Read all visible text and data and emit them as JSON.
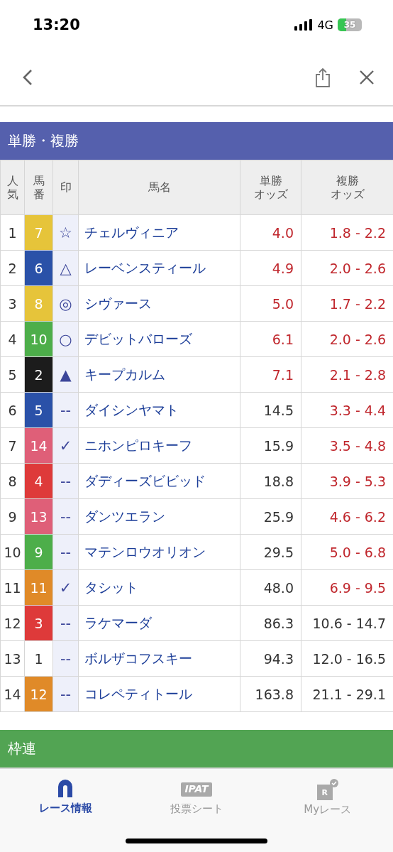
{
  "status_bar": {
    "time": "13:20",
    "network": "4G",
    "battery": "35"
  },
  "sections": [
    {
      "title": "単勝・複勝",
      "color": "#5560ad"
    },
    {
      "title": "枠連",
      "color": "#52a453"
    }
  ],
  "table": {
    "columns": [
      [
        "人",
        "気"
      ],
      [
        "馬",
        "番"
      ],
      [
        "印"
      ],
      [
        "馬名"
      ],
      [
        "単勝",
        "オッズ"
      ],
      [
        "複勝",
        "オッズ"
      ]
    ],
    "rows": [
      {
        "popularity": "1",
        "number": "7",
        "color": "#e6c43a",
        "mark": "☆",
        "name": "チェルヴィニア",
        "win": "4.0",
        "win_highlight": true,
        "place": "1.8 - 2.2",
        "place_highlight": true
      },
      {
        "popularity": "2",
        "number": "6",
        "color": "#2a51a8",
        "mark": "△",
        "name": "レーベンスティール",
        "win": "4.9",
        "win_highlight": true,
        "place": "2.0 - 2.6",
        "place_highlight": true
      },
      {
        "popularity": "3",
        "number": "8",
        "color": "#e6c43a",
        "mark": "◎",
        "name": "シヴァース",
        "win": "5.0",
        "win_highlight": true,
        "place": "1.7 - 2.2",
        "place_highlight": true
      },
      {
        "popularity": "4",
        "number": "10",
        "color": "#4dae4a",
        "mark": "○",
        "name": "デビットバローズ",
        "win": "6.1",
        "win_highlight": true,
        "place": "2.0 - 2.6",
        "place_highlight": true
      },
      {
        "popularity": "5",
        "number": "2",
        "color": "#1c1c1c",
        "mark": "▲",
        "name": "キープカルム",
        "win": "7.1",
        "win_highlight": true,
        "place": "2.1 - 2.8",
        "place_highlight": true
      },
      {
        "popularity": "6",
        "number": "5",
        "color": "#2a51a8",
        "mark": "--",
        "name": "ダイシンヤマト",
        "win": "14.5",
        "win_highlight": false,
        "place": "3.3 - 4.4",
        "place_highlight": true
      },
      {
        "popularity": "7",
        "number": "14",
        "color": "#df5f78",
        "mark": "✓",
        "name": "ニホンピロキーフ",
        "win": "15.9",
        "win_highlight": false,
        "place": "3.5 - 4.8",
        "place_highlight": true
      },
      {
        "popularity": "8",
        "number": "4",
        "color": "#de3a3a",
        "mark": "--",
        "name": "ダディーズビビッド",
        "win": "18.8",
        "win_highlight": false,
        "place": "3.9 - 5.3",
        "place_highlight": true
      },
      {
        "popularity": "9",
        "number": "13",
        "color": "#df5f78",
        "mark": "--",
        "name": "ダンツエラン",
        "win": "25.9",
        "win_highlight": false,
        "place": "4.6 - 6.2",
        "place_highlight": true
      },
      {
        "popularity": "10",
        "number": "9",
        "color": "#4dae4a",
        "mark": "--",
        "name": "マテンロウオリオン",
        "win": "29.5",
        "win_highlight": false,
        "place": "5.0 - 6.8",
        "place_highlight": true
      },
      {
        "popularity": "11",
        "number": "11",
        "color": "#e08a28",
        "mark": "✓",
        "name": "タシット",
        "win": "48.0",
        "win_highlight": false,
        "place": "6.9 - 9.5",
        "place_highlight": true
      },
      {
        "popularity": "12",
        "number": "3",
        "color": "#de3a3a",
        "mark": "--",
        "name": "ラケマーダ",
        "win": "86.3",
        "win_highlight": false,
        "place": "10.6 - 14.7",
        "place_highlight": false
      },
      {
        "popularity": "13",
        "number": "1",
        "color": "#ffffff",
        "mark": "--",
        "name": "ボルザコフスキー",
        "win": "94.3",
        "win_highlight": false,
        "place": "12.0 - 16.5",
        "place_highlight": false
      },
      {
        "popularity": "14",
        "number": "12",
        "color": "#e08a28",
        "mark": "--",
        "name": "コレペティトール",
        "win": "163.8",
        "win_highlight": false,
        "place": "21.1 - 29.1",
        "place_highlight": false
      }
    ]
  },
  "tab_bar": [
    {
      "kind": "horseshoe",
      "label": "レース情報",
      "selected": true
    },
    {
      "kind": "ipat",
      "icon_text": "IPAT",
      "label": "投票シート",
      "selected": false
    },
    {
      "kind": "myrace",
      "icon_text": "R",
      "label": "Myレース",
      "selected": false
    }
  ]
}
